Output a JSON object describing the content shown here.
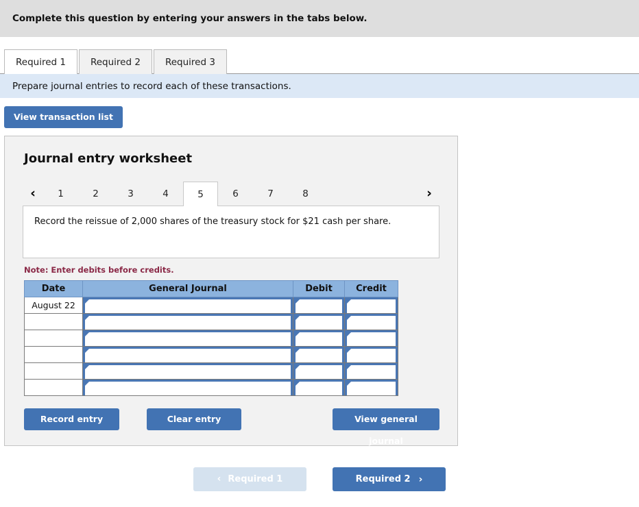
{
  "header": {
    "instruction": "Complete this question by entering your answers in the tabs below."
  },
  "required_tabs": [
    {
      "label": "Required 1",
      "active": true
    },
    {
      "label": "Required 2",
      "active": false
    },
    {
      "label": "Required 3",
      "active": false
    }
  ],
  "prompt": {
    "text": "Prepare journal entries to record each of these transactions."
  },
  "toolbar": {
    "view_transaction_list": "View transaction list"
  },
  "worksheet": {
    "title": "Journal entry worksheet",
    "prev_arrow": "‹",
    "next_arrow": "›",
    "tabs": [
      {
        "label": "1",
        "active": false
      },
      {
        "label": "2",
        "active": false
      },
      {
        "label": "3",
        "active": false
      },
      {
        "label": "4",
        "active": false
      },
      {
        "label": "5",
        "active": true
      },
      {
        "label": "6",
        "active": false
      },
      {
        "label": "7",
        "active": false
      },
      {
        "label": "8",
        "active": false
      }
    ],
    "description": "Record the reissue of 2,000 shares of the treasury stock for $21 cash per share.",
    "note": "Note: Enter debits before credits."
  },
  "journal_table": {
    "columns": [
      "Date",
      "General Journal",
      "Debit",
      "Credit"
    ],
    "rows": [
      {
        "date": "August 22",
        "account": "",
        "debit": "",
        "credit": ""
      },
      {
        "date": "",
        "account": "",
        "debit": "",
        "credit": ""
      },
      {
        "date": "",
        "account": "",
        "debit": "",
        "credit": ""
      },
      {
        "date": "",
        "account": "",
        "debit": "",
        "credit": ""
      },
      {
        "date": "",
        "account": "",
        "debit": "",
        "credit": ""
      },
      {
        "date": "",
        "account": "",
        "debit": "",
        "credit": ""
      }
    ]
  },
  "actions": {
    "record_entry": "Record entry",
    "clear_entry": "Clear entry",
    "view_general_journal": "View general journal"
  },
  "footer": {
    "prev_label": "Required 1",
    "next_label": "Required 2",
    "prev_chevron": "‹",
    "next_chevron": "›"
  },
  "colors": {
    "accent_blue": "#4273b3",
    "table_header_blue": "#8cb3de",
    "prompt_band_blue": "#dce8f6",
    "top_bar_gray": "#dedede",
    "panel_gray": "#f2f2f2",
    "note_red": "#8a2846",
    "disabled_blue": "#d5e2ef"
  }
}
